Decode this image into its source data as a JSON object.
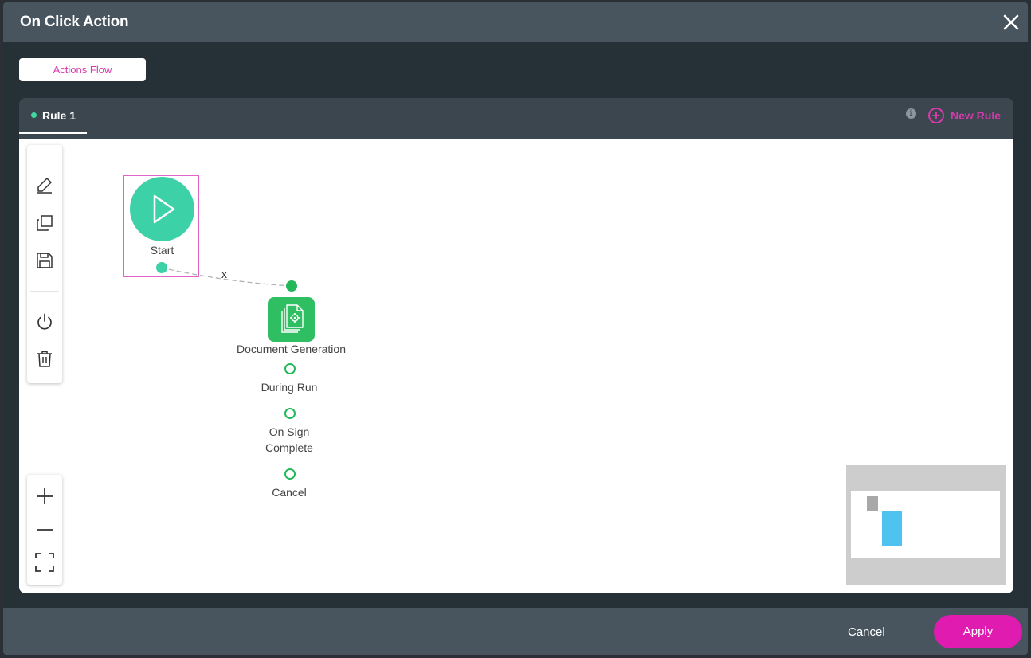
{
  "modal": {
    "title": "On Click Action"
  },
  "tabs": {
    "actions_flow": "Actions Flow"
  },
  "rules": {
    "active_rule": "Rule 1",
    "info_glyph": "i",
    "new_rule_label": "New Rule"
  },
  "toolbar": {
    "tools": [
      "pencil-icon",
      "copy-icon",
      "save-icon",
      "power-icon",
      "trash-icon"
    ],
    "zoom": [
      "zoom-in-icon",
      "zoom-out-icon",
      "fit-screen-icon"
    ]
  },
  "flow": {
    "start": {
      "label": "Start"
    },
    "edge_delete": "x",
    "document_generation": {
      "label": "Document Generation",
      "outputs": [
        "During Run",
        "On Sign\nComplete",
        "Cancel"
      ]
    }
  },
  "footer": {
    "cancel_label": "Cancel",
    "apply_label": "Apply"
  },
  "colors": {
    "header_bg": "#48555e",
    "accent_pink": "#e01bb0",
    "start_teal": "#3dd1a8",
    "doc_green": "#2fbf62",
    "minimap_highlight": "#4fc3f0"
  }
}
